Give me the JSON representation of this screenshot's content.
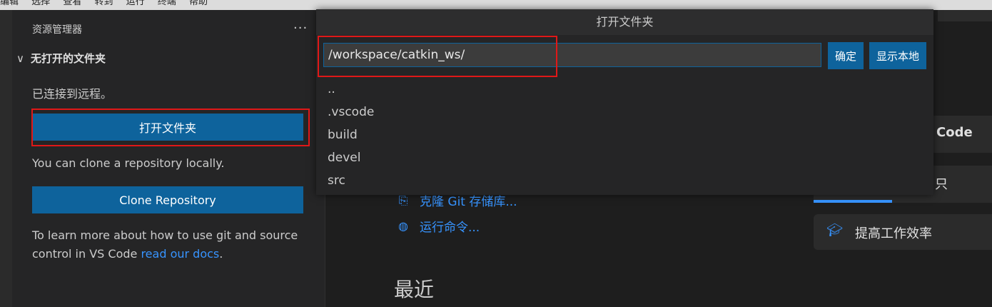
{
  "menubar": [
    "编辑",
    "选择",
    "查看",
    "转到",
    "运行",
    "终端",
    "帮助"
  ],
  "sidebar": {
    "title": "资源管理器",
    "more": "...",
    "section_title": "无打开的文件夹",
    "connected_text": "已连接到远程。",
    "open_folder_label": "打开文件夹",
    "clone_text": "You can clone a repository locally.",
    "clone_button_label": "Clone Repository",
    "learn_text": "To learn more about how to use git and source control in VS Code ",
    "learn_link": "read our docs",
    "learn_end": "."
  },
  "dialog": {
    "title": "打开文件夹",
    "path_value": "/workspace/catkin_ws/",
    "ok_label": "确定",
    "show_local_label": "显示本地",
    "entries": [
      "..",
      ".vscode",
      "build",
      "devel",
      "src"
    ]
  },
  "welcome": {
    "clone_git_label": "克隆 Git 存储库...",
    "run_command_label": "运行命令...",
    "recent_title": "最近",
    "code_label": "Code",
    "partial_label": "只",
    "productivity_label": "提高工作效率"
  },
  "colors": {
    "accent": "#0e639c",
    "link": "#3794ff",
    "highlight_box": "#e01818"
  }
}
